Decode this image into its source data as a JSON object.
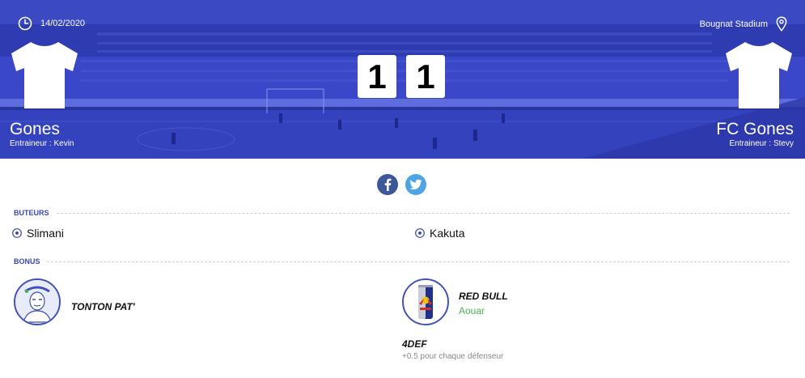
{
  "match": {
    "date": "14/02/2020",
    "stadium": "Bougnat Stadium",
    "home": {
      "name": "Gones",
      "coach": "Entraineur : Kevin",
      "score": "1"
    },
    "away": {
      "name": "FC Gones",
      "coach": "Entraineur : Stevy",
      "score": "1"
    }
  },
  "sections": {
    "scorers_title": "BUTEURS",
    "bonus_title": "BONUS"
  },
  "scorers": {
    "home": [
      "Slimani"
    ],
    "away": [
      "Kakuta"
    ]
  },
  "bonus": {
    "home": {
      "name": "TONTON PAT'",
      "icon": "tonton-pat-avatar-icon"
    },
    "away": {
      "name": "RED BULL",
      "player": "Aouar",
      "icon": "red-bull-can-icon"
    },
    "extra": {
      "name": "4DEF",
      "desc": "+0.5 pour chaque défenseur"
    }
  },
  "colors": {
    "hero_overlay": "#3a47c9",
    "accent": "#3949ab",
    "facebook": "#3b5998",
    "twitter": "#4fa4e5",
    "bonus_player": "#4caf50"
  }
}
